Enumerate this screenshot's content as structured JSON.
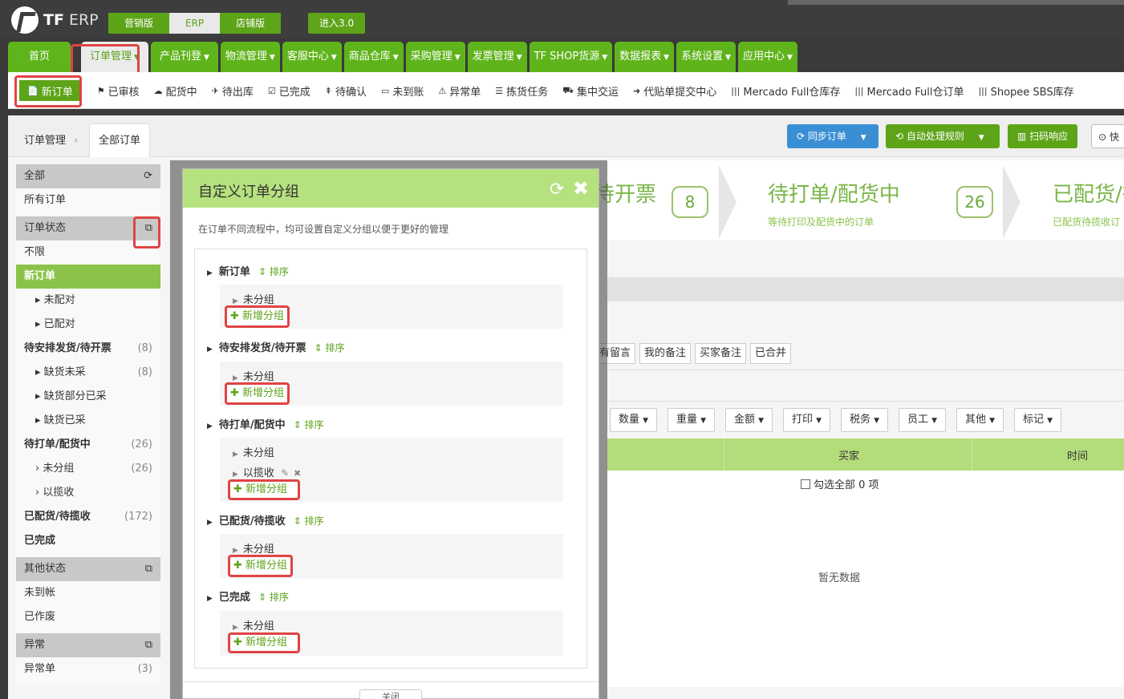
{
  "brand": {
    "logo": "TF",
    "erp": "ERP"
  },
  "versions": [
    "营销版",
    "ERP",
    "店铺版"
  ],
  "enter": "进入3.0",
  "mainnav": [
    "首页",
    "订单管理",
    "产品刊登",
    "物流管理",
    "客服中心",
    "商品仓库",
    "采购管理",
    "发票管理",
    "TF SHOP货源",
    "数据报表",
    "系统设置",
    "应用中心"
  ],
  "subnav": [
    {
      "icon": "📄",
      "label": "新订单"
    },
    {
      "icon": "⚑",
      "label": "已审核"
    },
    {
      "icon": "☁",
      "label": "配货中"
    },
    {
      "icon": "✈",
      "label": "待出库"
    },
    {
      "icon": "☑",
      "label": "已完成"
    },
    {
      "icon": "⇞",
      "label": "待确认"
    },
    {
      "icon": "▭",
      "label": "未到账"
    },
    {
      "icon": "⚠",
      "label": "异常单"
    },
    {
      "icon": "☰",
      "label": "拣货任务"
    },
    {
      "icon": "⛟",
      "label": "集中交运"
    },
    {
      "icon": "➜",
      "label": "代贴单提交中心"
    },
    {
      "icon": "|||",
      "label": "Mercado Full仓库存"
    },
    {
      "icon": "|||",
      "label": "Mercado Full仓订单"
    },
    {
      "icon": "|||",
      "label": "Shopee SBS库存"
    }
  ],
  "crumb": {
    "a": "订单管理",
    "b": "全部订单"
  },
  "topbtns": {
    "sync": "同步订单",
    "auto": "自动处理规则",
    "scan": "扫码响应",
    "fast": "快"
  },
  "sidebar": {
    "all": "全部",
    "allorders": "所有订单",
    "status": "订单状态",
    "nolimit": "不限",
    "neworder": "新订单",
    "unmatched": "未配对",
    "matched": "已配对",
    "pending": "待安排发货/待开票",
    "pending_cnt": "(8)",
    "short": "缺货未采",
    "short_cnt": "(8)",
    "partial": "缺货部分已采",
    "bought": "缺货已采",
    "printing": "待打单/配货中",
    "printing_cnt": "(26)",
    "ungrouped": "未分组",
    "ungrouped_cnt": "(26)",
    "collected": "以揽收",
    "shipped": "已配货/待揽收",
    "shipped_cnt": "(172)",
    "done": "已完成",
    "other": "其他状态",
    "unpaid": "未到帐",
    "void": "已作废",
    "abnormal": "异常",
    "abnormal_list": "异常单",
    "abnormal_cnt": "(3)"
  },
  "stats": {
    "s1": "待开票",
    "n1": "8",
    "s2": "待打单/配货中",
    "s2sub": "等待打印及配货中的订单",
    "n2": "26",
    "s3": "已配货/待",
    "s3sub": "已配货待揽收订"
  },
  "tags": [
    "有留言",
    "我的备注",
    "买家备注",
    "已合并"
  ],
  "filters": [
    "数量",
    "重量",
    "金额",
    "打印",
    "税务",
    "员工",
    "其他",
    "标记"
  ],
  "table": {
    "buyer": "买家",
    "time": "时间",
    "selectall": "勾选全部 0 项",
    "empty": "暂无数据"
  },
  "modal": {
    "title": "自定义订单分组",
    "desc": "在订单不同流程中，均可设置自定义分组以便于更好的管理",
    "sort": "排序",
    "ungrouped": "未分组",
    "add": "新增分组",
    "collected": "以揽收",
    "close": "关闭",
    "sections": [
      "新订单",
      "待安排发货/待开票",
      "待打单/配货中",
      "已配货/待揽收",
      "已完成"
    ]
  }
}
